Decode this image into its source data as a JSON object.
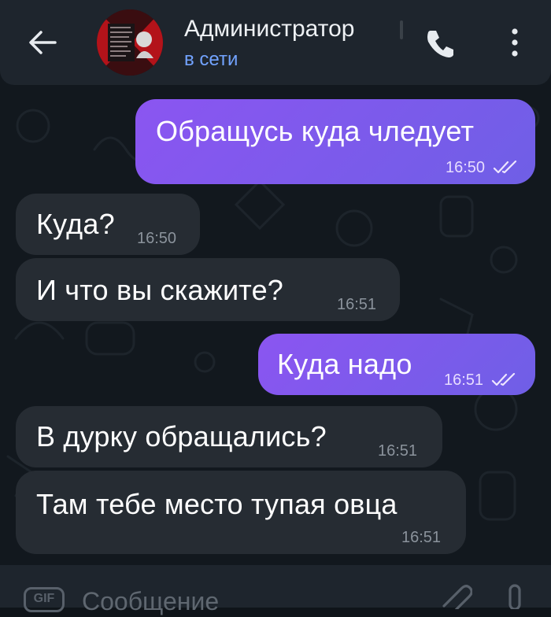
{
  "header": {
    "title": "Администратор",
    "status": "в сети"
  },
  "messages": [
    {
      "direction": "out",
      "text": "Обращусь куда чледует",
      "time": "16:50",
      "read": true
    },
    {
      "direction": "in",
      "text": "Куда?",
      "time": "16:50"
    },
    {
      "direction": "in",
      "text": "И что вы скажите?",
      "time": "16:51"
    },
    {
      "direction": "out",
      "text": "Куда надо",
      "time": "16:51",
      "read": true
    },
    {
      "direction": "in",
      "text": "В дурку обращались?",
      "time": "16:51"
    },
    {
      "direction": "in",
      "text": "Там тебе место тупая овца",
      "time": "16:51"
    }
  ],
  "composer": {
    "gif_label": "GIF",
    "placeholder": "Сообщение"
  },
  "colors": {
    "accent": "#72a3ff",
    "outgoing_bubble": "#7d59ee",
    "incoming_bubble": "#262c33",
    "header_bg": "#1e252d"
  },
  "icons": [
    "back-arrow-icon",
    "avatar",
    "phone-icon",
    "more-vertical-icon",
    "read-ticks-icon",
    "gif-icon",
    "attach-icon",
    "microphone-icon"
  ]
}
